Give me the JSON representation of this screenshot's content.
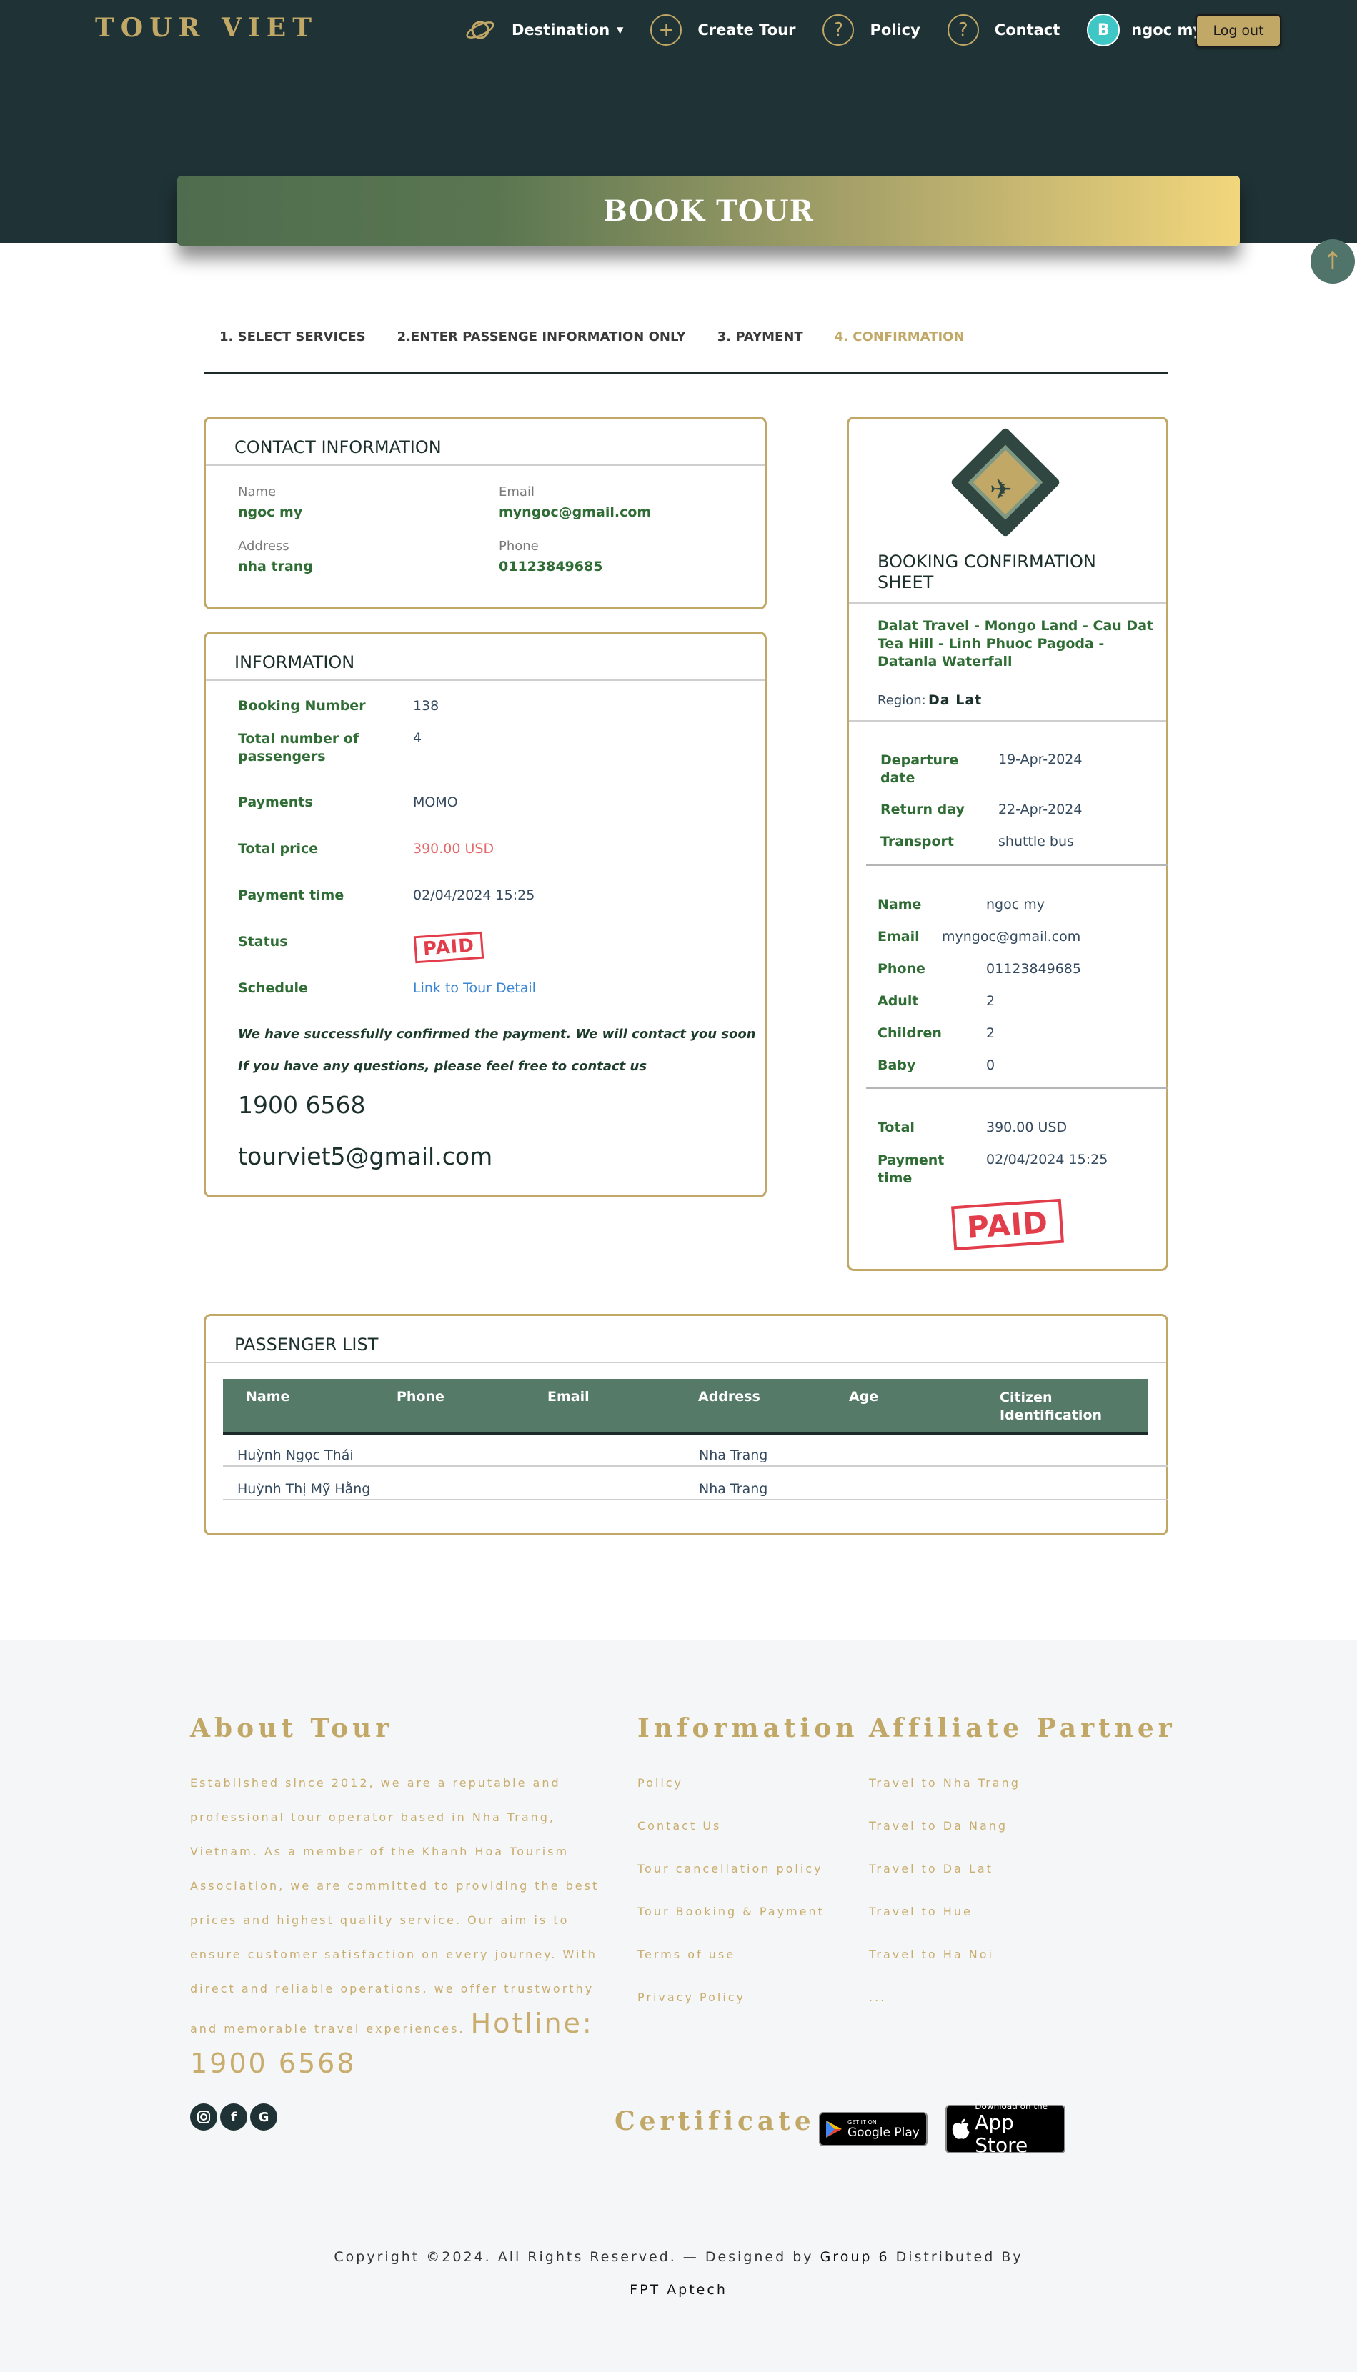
{
  "brand": "TOUR VIET",
  "nav": {
    "destination": "Destination",
    "create_tour": "Create Tour",
    "policy": "Policy",
    "contact": "Contact",
    "user_name": "ngoc my",
    "avatar_letter": "B",
    "logout": "Log out"
  },
  "banner": {
    "title": "BOOK TOUR"
  },
  "scroll_top": "↑",
  "steps": [
    {
      "label": "1. SELECT SERVICES"
    },
    {
      "label": "2.ENTER PASSENGE INFORMATION ONLY"
    },
    {
      "label": "3. PAYMENT"
    },
    {
      "label": "4. CONFIRMATION"
    }
  ],
  "contact": {
    "title": "CONTACT INFORMATION",
    "name_label": "Name",
    "name": "ngoc my",
    "email_label": "Email",
    "email": "myngoc@gmail.com",
    "address_label": "Address",
    "address": "nha trang",
    "phone_label": "Phone",
    "phone": "01123849685"
  },
  "info": {
    "title": "INFORMATION",
    "booking_number_label": "Booking Number",
    "booking_number": "138",
    "passengers_label": "Total number of passengers",
    "passengers": "4",
    "payments_label": "Payments",
    "payments": "MOMO",
    "total_price_label": "Total price",
    "total_price": "390.00 USD",
    "payment_time_label": "Payment time",
    "payment_time": "02/04/2024 15:25",
    "status_label": "Status",
    "status": "PAID",
    "schedule_label": "Schedule",
    "schedule_link": "Link to Tour Detail",
    "confirm_msg": "We have successfully confirmed the payment. We will contact you soon",
    "question_msg": "If you have any questions, please feel free to contact us",
    "hotline": "1900 6568",
    "support_email": "tourviet5@gmail.com"
  },
  "sheet": {
    "title": "BOOKING CONFIRMATION SHEET",
    "tour_name": "Dalat Travel - Mongo Land - Cau Dat Tea Hill - Linh Phuoc Pagoda - Datanla Waterfall",
    "region_label": "Region:",
    "region": "Da Lat",
    "departure_label": "Departure date",
    "departure": "19-Apr-2024",
    "return_label": "Return day",
    "return": "22-Apr-2024",
    "transport_label": "Transport",
    "transport": "shuttle bus",
    "name_label": "Name",
    "name": "ngoc my",
    "email_label": "Email",
    "email": "myngoc@gmail.com",
    "phone_label": "Phone",
    "phone": "01123849685",
    "adult_label": "Adult",
    "adult": "2",
    "children_label": "Children",
    "children": "2",
    "baby_label": "Baby",
    "baby": "0",
    "total_label": "Total",
    "total": "390.00 USD",
    "payment_time_label": "Payment time",
    "payment_time": "02/04/2024 15:25",
    "stamp": "PAID"
  },
  "passengers": {
    "title": "PASSENGER LIST",
    "columns": [
      "Name",
      "Phone",
      "Email",
      "Address",
      "Age",
      "Citizen Identification"
    ],
    "rows": [
      {
        "name": "Huỳnh Ngọc Thái",
        "phone": "",
        "email": "",
        "address": "Nha Trang",
        "age": "",
        "citizen_id": ""
      },
      {
        "name": "Huỳnh Thị Mỹ Hằng",
        "phone": "",
        "email": "",
        "address": "Nha Trang",
        "age": "",
        "citizen_id": ""
      }
    ]
  },
  "footer": {
    "about_title": "About Tour",
    "about_text": "Established since 2012, we are a reputable and professional tour operator based in Nha Trang, Vietnam. As a member of the Khanh Hoa Tourism Association, we are committed to providing the best prices and highest quality service. Our aim is to ensure customer satisfaction on every journey. With direct and reliable operations, we offer trustworthy and memorable travel experiences.",
    "hotline": "Hotline: 1900 6568",
    "info_title": "Information",
    "info_links": [
      "Policy",
      "Contact Us",
      "Tour cancellation policy",
      "Tour Booking & Payment",
      "Terms of use",
      "Privacy Policy"
    ],
    "partner_title": "Affiliate Partner",
    "partner_links": [
      "Travel to Nha Trang",
      "Travel to Da Nang",
      "Travel to Da Lat",
      "Travel to Hue",
      "Travel to Ha Noi",
      "..."
    ],
    "certificate_title": "Certificate",
    "google_play_small": "GET IT ON",
    "google_play": "Google Play",
    "app_store_small": "Download on the",
    "app_store": "App Store",
    "social_icons": [
      "instagram-icon",
      "facebook-icon",
      "google-icon"
    ],
    "copyright_prefix": "Copyright ©2024. All Rights Reserved. — Designed by",
    "designer": "Group 6",
    "distributed": "Distributed By",
    "distributor": "FPT Aptech"
  },
  "colors": {
    "gold": "#c2a866",
    "dark": "#1f3235",
    "green": "#2f6d35",
    "table_head": "#557a68",
    "paid": "#e23d4b"
  }
}
